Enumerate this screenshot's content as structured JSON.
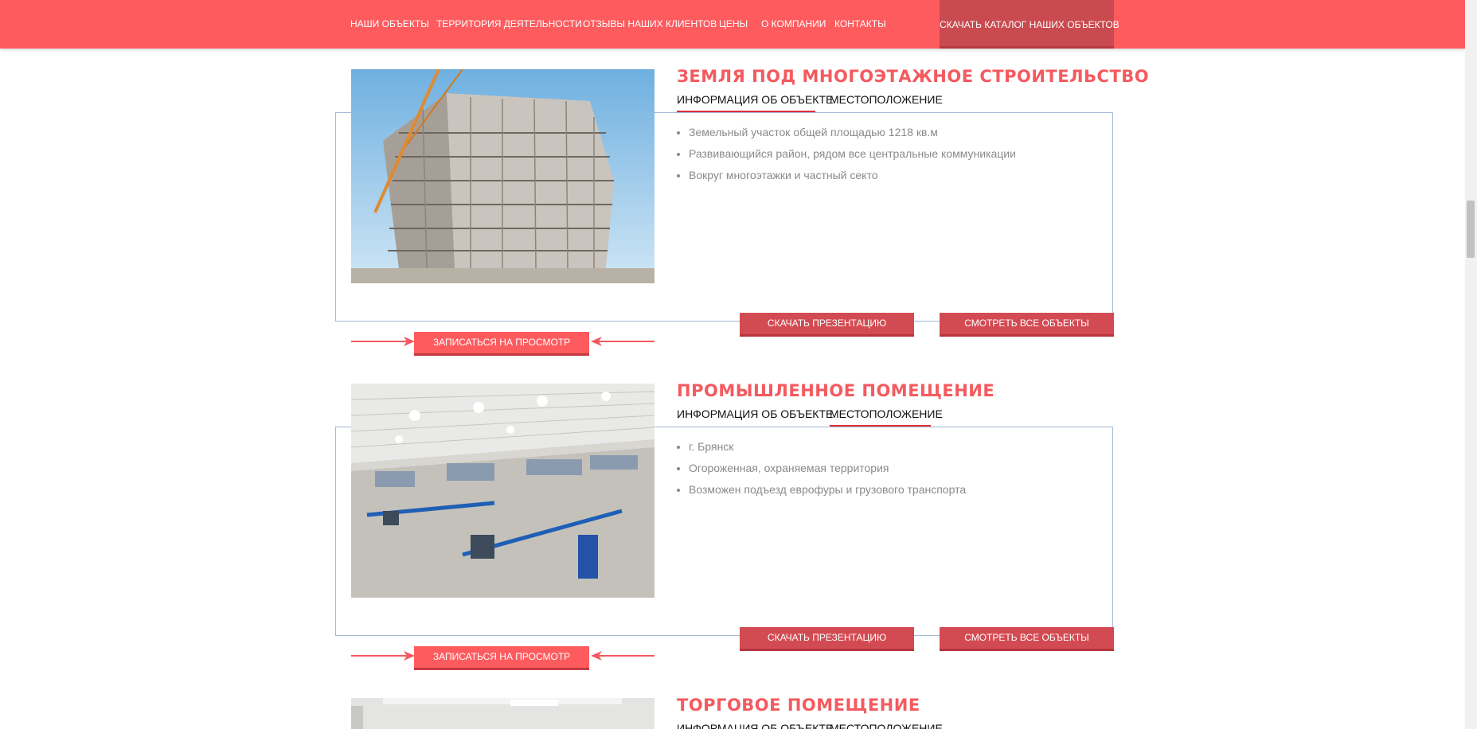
{
  "nav": {
    "items": [
      {
        "label": "НАШИ ОБЪЕКТЫ"
      },
      {
        "label": "ТЕРРИТОРИЯ ДЕЯТЕЛЬНОСТИ"
      },
      {
        "label": "ОТЗЫВЫ НАШИХ КЛИЕНТОВ"
      },
      {
        "label": "ЦЕНЫ"
      },
      {
        "label": "О КОМПАНИИ"
      },
      {
        "label": "КОНТАКТЫ"
      }
    ],
    "catalog_label": "СКАЧАТЬ КАТАЛОГ НАШИХ ОБЪЕКТОВ"
  },
  "tabs": {
    "info": "ИНФОРМАЦИЯ ОБ ОБЪЕКТЕ",
    "location": "МЕСТОПОЛОЖЕНИЕ"
  },
  "buttons": {
    "presentation": "СКАЧАТЬ ПРЕЗЕНТАЦИЮ",
    "all_objects": "СМОТРЕТЬ ВСЕ ОБЪЕКТЫ",
    "signup": "ЗАПИСАТЬСЯ НА ПРОСМОТР"
  },
  "objects": [
    {
      "title": "ЗЕМЛЯ ПОД МНОГОЭТАЖНОЕ СТРОИТЕЛЬСТВО",
      "active_tab": "info",
      "bullets": [
        "Земельный участок общей площадью 1218 кв.м",
        "Развивающийся район, рядом все центральные коммуникации",
        "Вокруг многоэтажки и частный секто"
      ]
    },
    {
      "title": "ПРОМЫШЛЕННОЕ ПОМЕЩЕНИЕ",
      "active_tab": "location",
      "bullets": [
        "г. Брянск",
        "Огороженная, охраняемая территория",
        "Возможен подъезд еврофуры и грузового транспорта"
      ]
    },
    {
      "title": "ТОРГОВОЕ ПОМЕЩЕНИЕ",
      "active_tab": "info",
      "bullets": []
    }
  ],
  "colors": {
    "accent": "#fe5b5e",
    "button": "#d34b52",
    "title": "#f45a5f",
    "frame": "#a3b8d8"
  }
}
